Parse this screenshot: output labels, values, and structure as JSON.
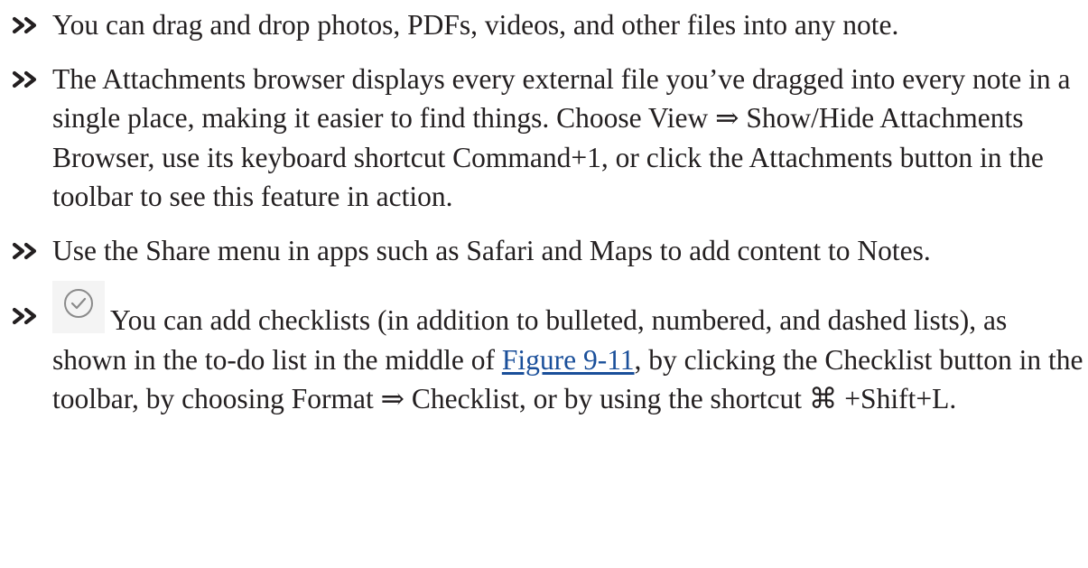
{
  "items": [
    {
      "text": "You can drag and drop photos, PDFs, videos, and other files into any note."
    },
    {
      "text": "The Attachments browser displays every external file you’ve dragged into every note in a single place, making it easier to find things. Choose View ⇒ Show/Hide Attachments Browser, use its keyboard shortcut Command+1, or click the Attachments button in the toolbar to see this feature in action."
    },
    {
      "text": "Use the Share menu in apps such as Safari and Maps to add content to Notes."
    },
    {
      "icon": "checklist-icon",
      "text_before_link": "You can add checklists (in addition to bulleted, numbered, and dashed lists), as shown in the to-do list in the middle of ",
      "link": "Figure 9-11",
      "text_after_link": ", by clicking the Checklist button in the toolbar, by choosing Format ⇒ Checklist, or by using the shortcut ⌘ +Shift+L."
    }
  ],
  "colors": {
    "text": "#231f20",
    "bullet": "#231f20",
    "link": "#1a4f9a"
  },
  "bullet_icon": "double-chevron-right-icon"
}
